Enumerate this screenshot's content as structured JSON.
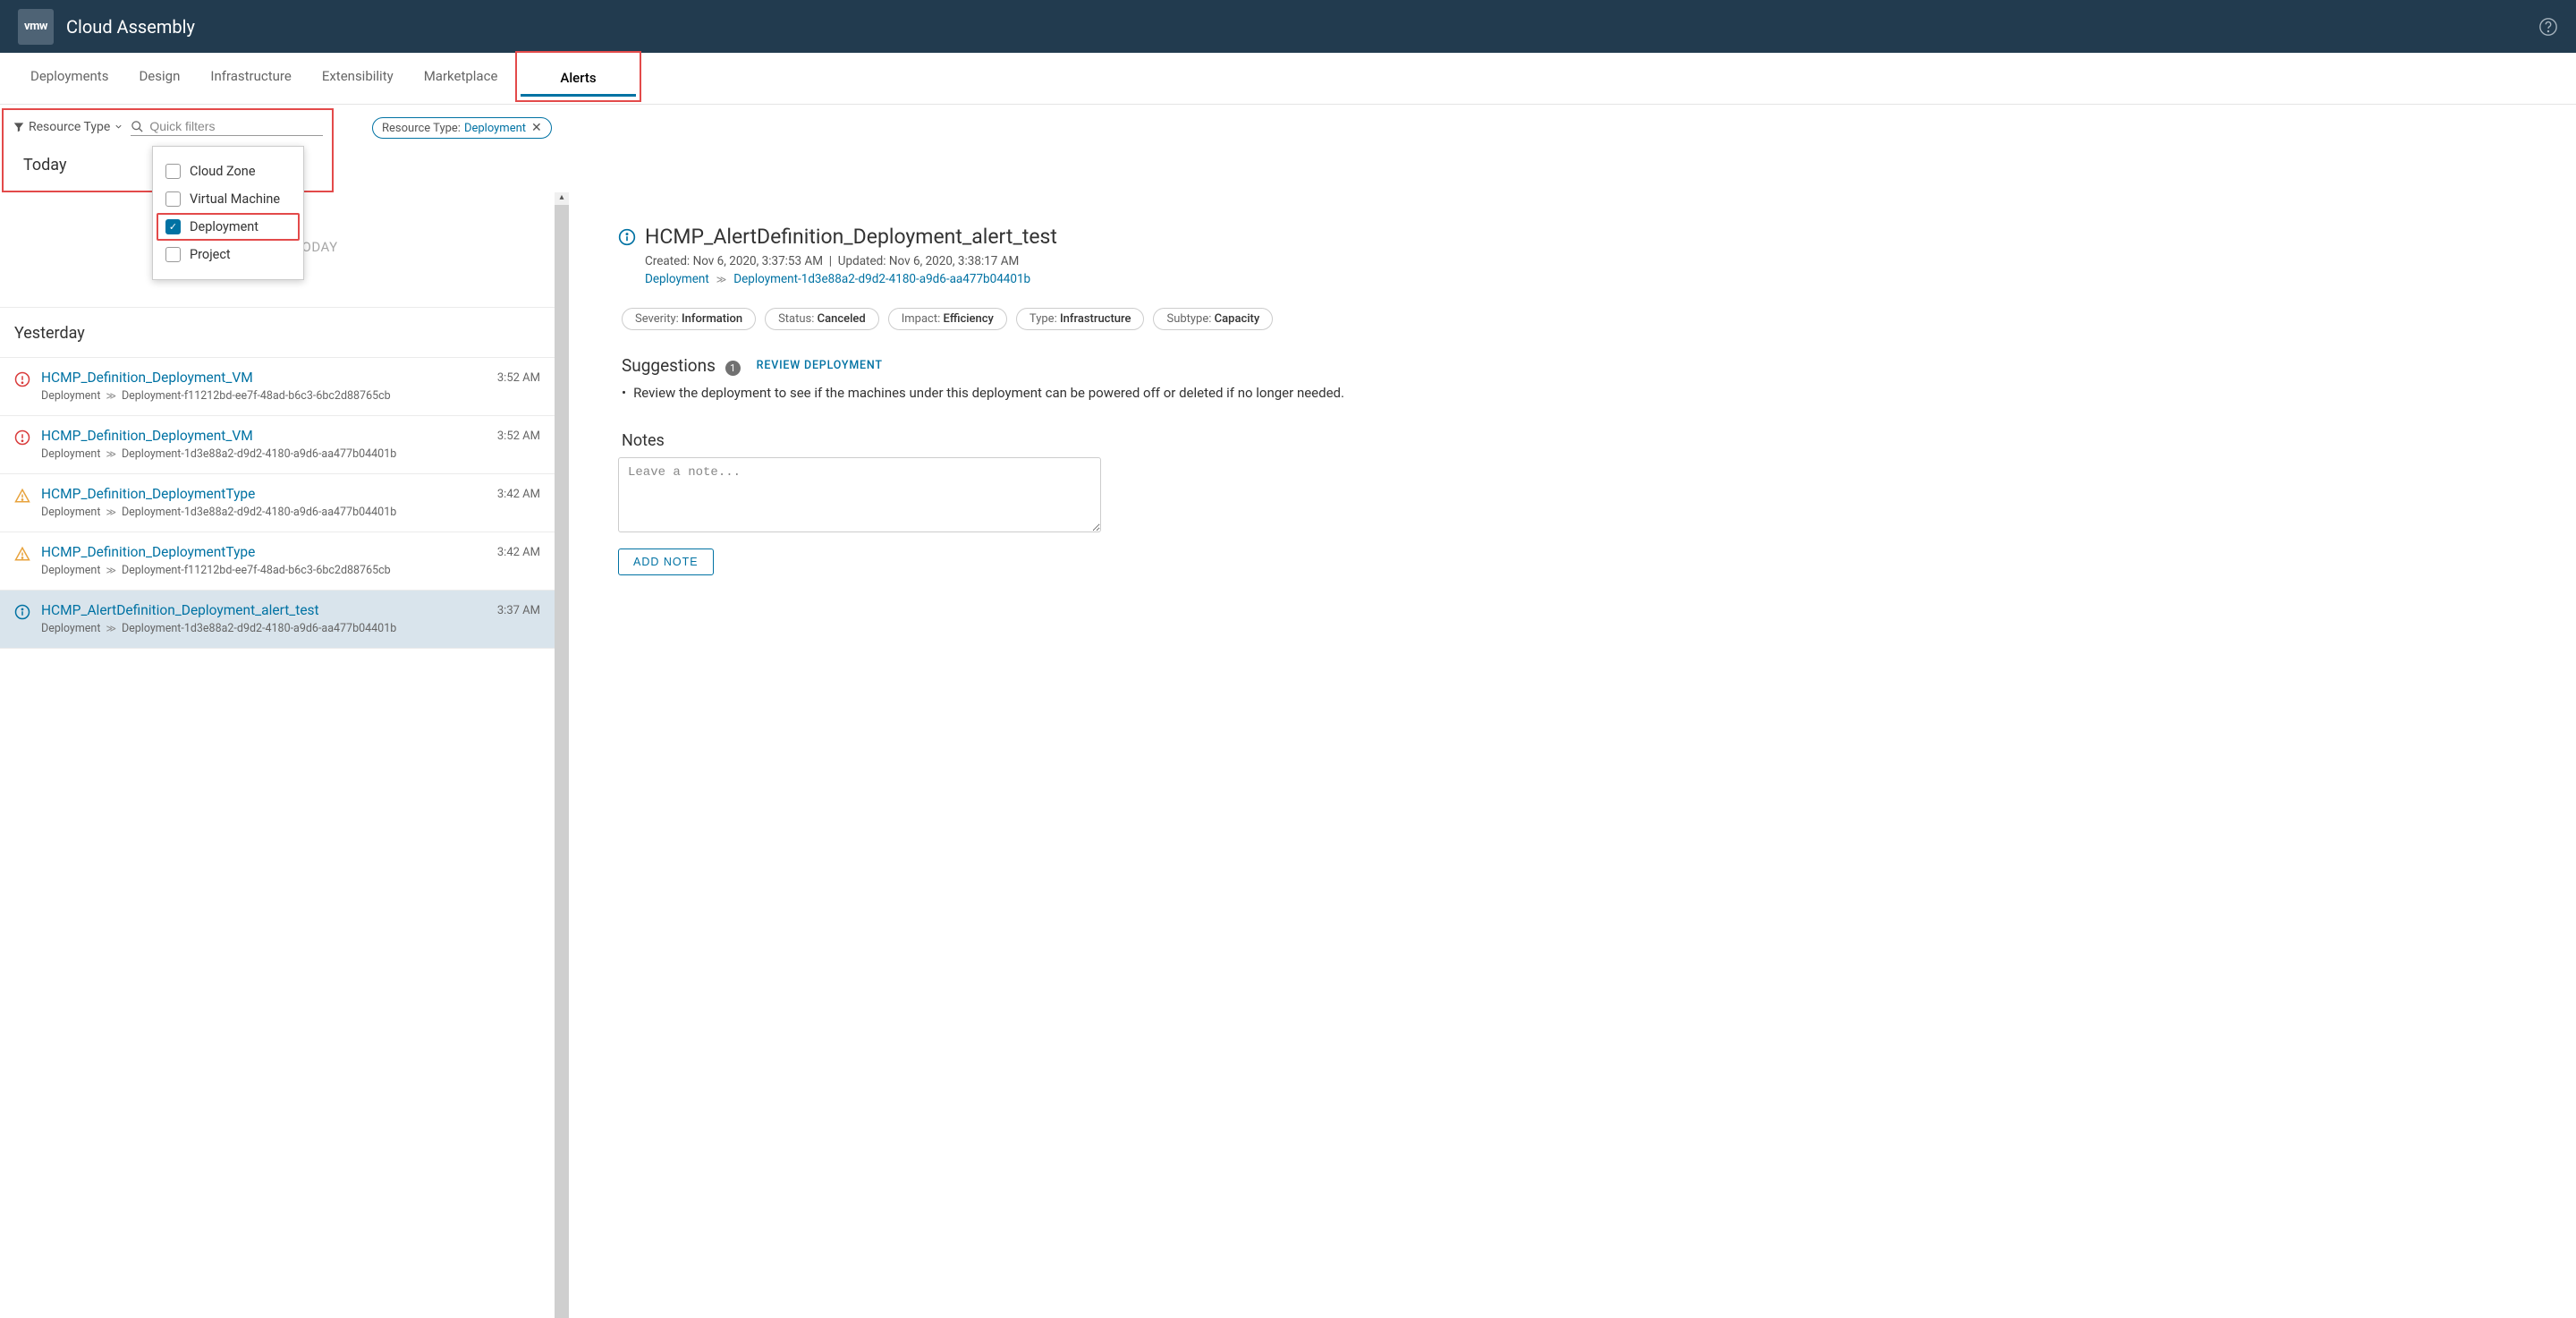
{
  "header": {
    "logo_text": "vmw",
    "title": "Cloud Assembly"
  },
  "nav": {
    "tabs": [
      "Deployments",
      "Design",
      "Infrastructure",
      "Extensibility",
      "Marketplace",
      "Alerts"
    ],
    "active": "Alerts"
  },
  "filter": {
    "button_label": "Resource Type",
    "search_placeholder": "Quick filters",
    "chip_label": "Resource Type:",
    "chip_value": "Deployment",
    "options": [
      {
        "label": "Cloud Zone",
        "checked": false
      },
      {
        "label": "Virtual Machine",
        "checked": false
      },
      {
        "label": "Deployment",
        "checked": true
      },
      {
        "label": "Project",
        "checked": false
      }
    ]
  },
  "list": {
    "today_label": "Today",
    "no_alerts_text": "NO ALERTS TODAY",
    "yesterday_label": "Yesterday",
    "items": [
      {
        "sev": "crit",
        "title": "HCMP_Definition_Deployment_VM",
        "bc1": "Deployment",
        "bc2": "Deployment-f11212bd-ee7f-48ad-b6c3-6bc2d88765cb",
        "time": "3:52 AM"
      },
      {
        "sev": "crit",
        "title": "HCMP_Definition_Deployment_VM",
        "bc1": "Deployment",
        "bc2": "Deployment-1d3e88a2-d9d2-4180-a9d6-aa477b04401b",
        "time": "3:52 AM"
      },
      {
        "sev": "warn",
        "title": "HCMP_Definition_DeploymentType",
        "bc1": "Deployment",
        "bc2": "Deployment-1d3e88a2-d9d2-4180-a9d6-aa477b04401b",
        "time": "3:42 AM"
      },
      {
        "sev": "warn",
        "title": "HCMP_Definition_DeploymentType",
        "bc1": "Deployment",
        "bc2": "Deployment-f11212bd-ee7f-48ad-b6c3-6bc2d88765cb",
        "time": "3:42 AM"
      },
      {
        "sev": "info",
        "title": "HCMP_AlertDefinition_Deployment_alert_test",
        "bc1": "Deployment",
        "bc2": "Deployment-1d3e88a2-d9d2-4180-a9d6-aa477b04401b",
        "time": "3:37 AM"
      }
    ]
  },
  "detail": {
    "title": "HCMP_AlertDefinition_Deployment_alert_test",
    "created_label": "Created:",
    "created_value": "Nov 6, 2020, 3:37:53 AM",
    "updated_label": "Updated:",
    "updated_value": "Nov 6, 2020, 3:38:17 AM",
    "bc1": "Deployment",
    "bc2": "Deployment-1d3e88a2-d9d2-4180-a9d6-aa477b04401b",
    "tags": [
      {
        "k": "Severity:",
        "v": "Information"
      },
      {
        "k": "Status:",
        "v": "Canceled"
      },
      {
        "k": "Impact:",
        "v": "Efficiency"
      },
      {
        "k": "Type:",
        "v": "Infrastructure"
      },
      {
        "k": "Subtype:",
        "v": "Capacity"
      }
    ],
    "suggestions_label": "Suggestions",
    "suggestions_count": "1",
    "review_link": "REVIEW DEPLOYMENT",
    "suggestion_text": "Review the deployment to see if the machines under this deployment can be powered off or deleted if no longer needed.",
    "notes_label": "Notes",
    "notes_placeholder": "Leave a note...",
    "add_note_label": "ADD NOTE"
  }
}
